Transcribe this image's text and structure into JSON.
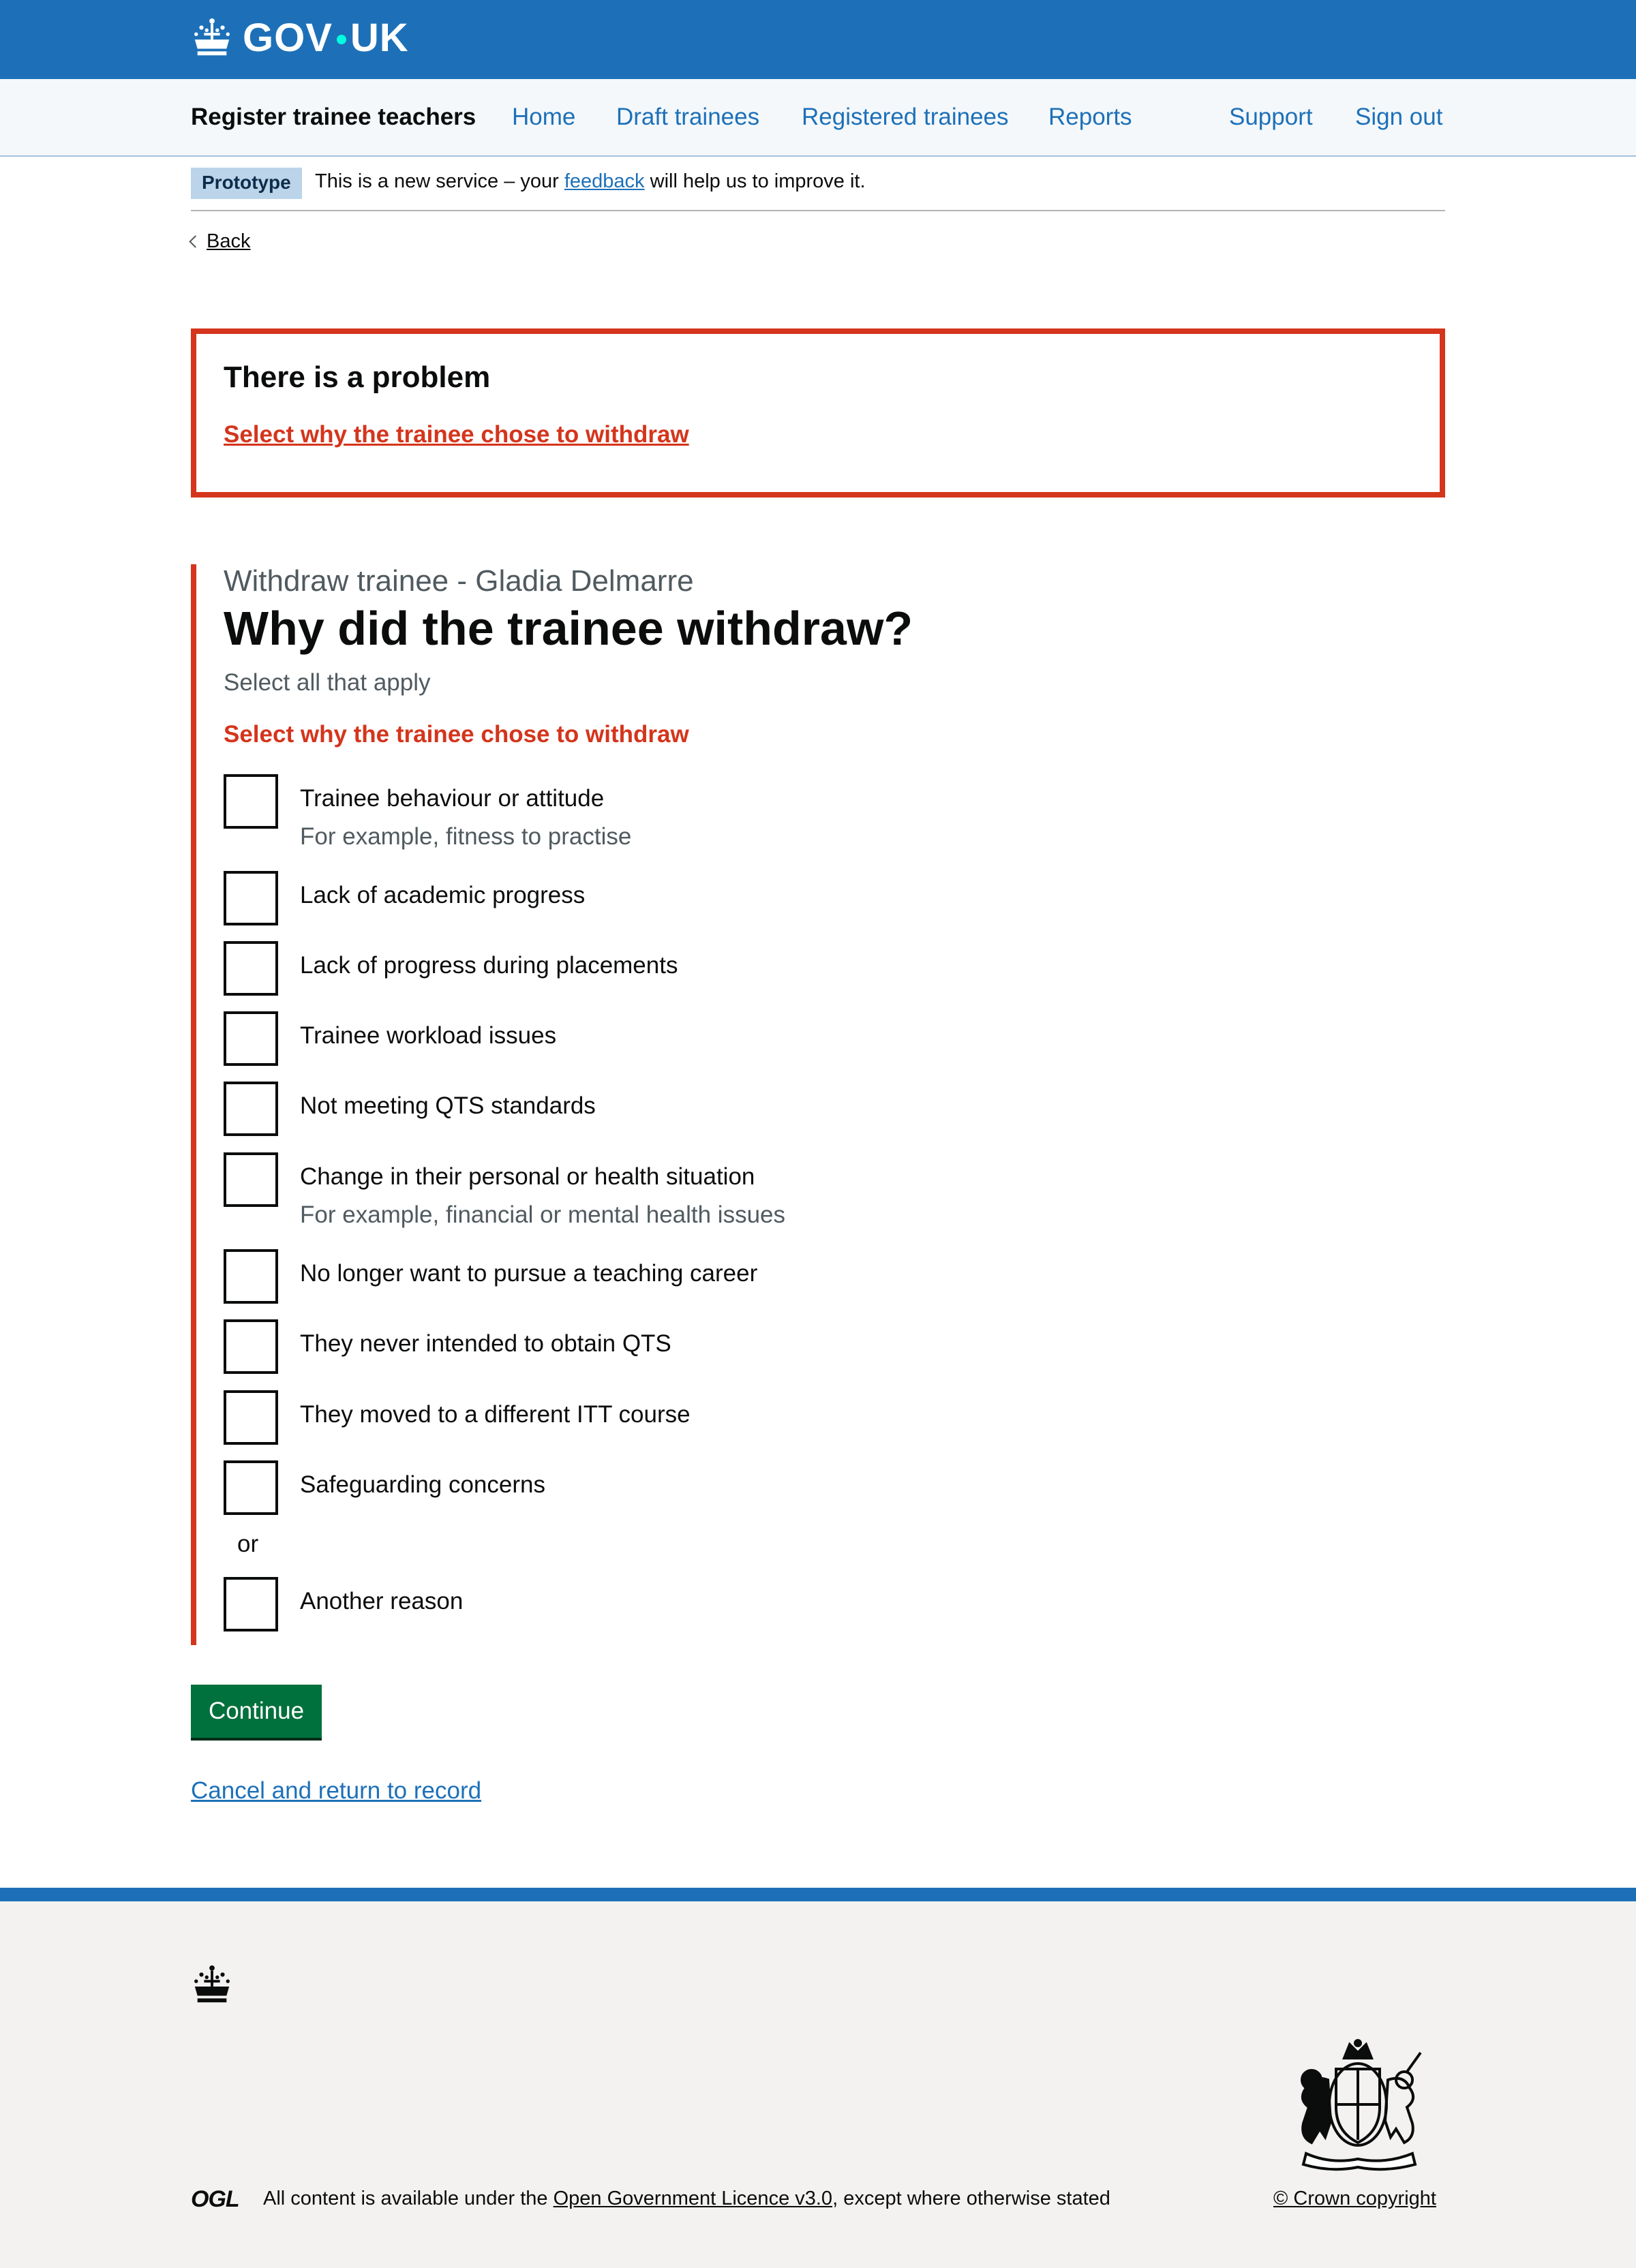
{
  "header": {
    "logo_text_left": "GOV",
    "logo_text_right": "UK"
  },
  "service_nav": {
    "service_name": "Register trainee teachers",
    "links": [
      "Home",
      "Draft trainees",
      "Registered trainees",
      "Reports"
    ],
    "right_links": [
      "Support",
      "Sign out"
    ]
  },
  "phase_banner": {
    "tag": "Prototype",
    "text_before": "This is a new service – your ",
    "link": "feedback",
    "text_after": " will help us to improve it."
  },
  "back_link": "Back",
  "error_summary": {
    "title": "There is a problem",
    "error_link": "Select why the trainee chose to withdraw"
  },
  "form": {
    "caption": "Withdraw trainee - Gladia Delmarre",
    "question": "Why did the trainee withdraw?",
    "hint": "Select all that apply",
    "error_message": "Select why the trainee chose to withdraw",
    "options": [
      {
        "label": "Trainee behaviour or attitude",
        "hint": "For example, fitness to practise"
      },
      {
        "label": "Lack of academic progress"
      },
      {
        "label": "Lack of progress during placements"
      },
      {
        "label": "Trainee workload issues"
      },
      {
        "label": "Not meeting QTS standards"
      },
      {
        "label": "Change in their personal or health situation",
        "hint": "For example, financial or mental health issues"
      },
      {
        "label": "No longer want to pursue a teaching career"
      },
      {
        "label": "They never intended to obtain QTS"
      },
      {
        "label": "They moved to a different ITT course"
      },
      {
        "label": "Safeguarding concerns"
      }
    ],
    "divider": "or",
    "other_option": {
      "label": "Another reason"
    },
    "continue_label": "Continue",
    "cancel_link": "Cancel and return to record"
  },
  "footer": {
    "ogl": "OGL",
    "licence_before": "All content is available under the ",
    "licence_link": "Open Government Licence v3.0",
    "licence_after": ", except where otherwise stated",
    "copyright": "© Crown copyright"
  },
  "colors": {
    "header_blue": "#1d70b8",
    "error_red": "#d4351c",
    "button_green": "#00703c"
  }
}
